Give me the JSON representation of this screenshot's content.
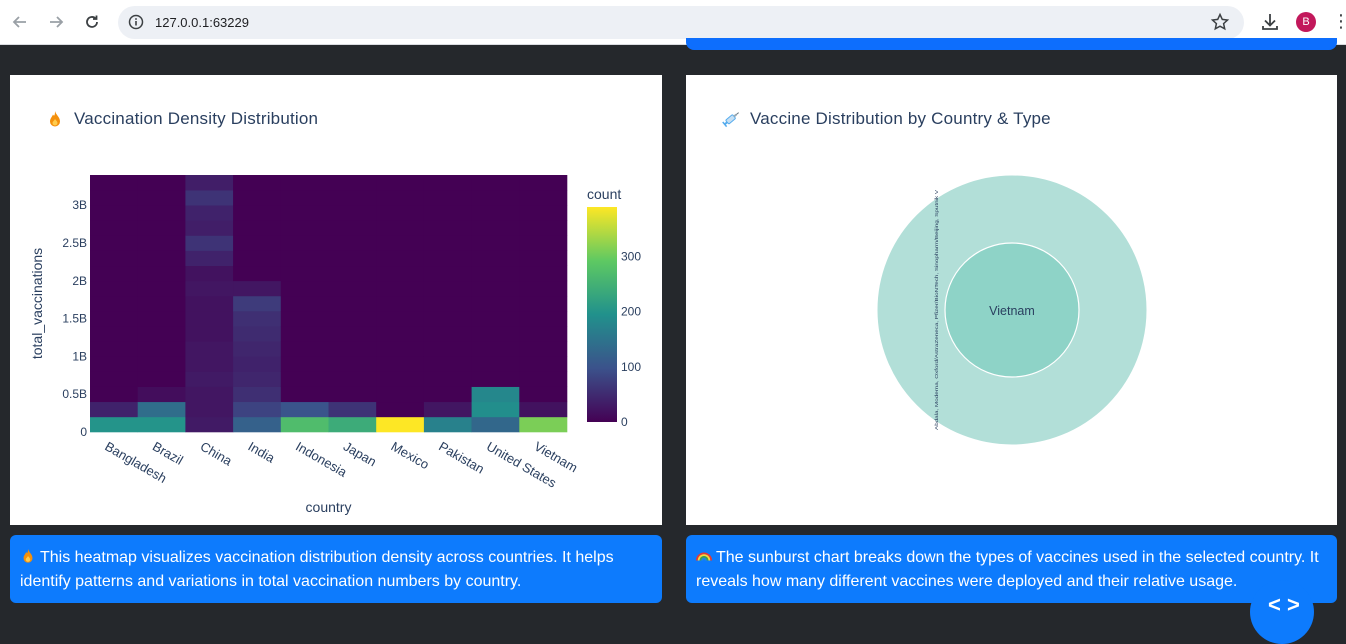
{
  "browser": {
    "url": "127.0.0.1:63229",
    "avatar_letter": "B"
  },
  "heatmap_card": {
    "title": "Vaccination Density Distribution",
    "title_icon": "fire-icon",
    "colorbar_title": "count",
    "colorbar_ticks": [
      "0",
      "100",
      "200",
      "300"
    ],
    "description": "This heatmap visualizes vaccination distribution density across countries. It helps identify patterns and variations in total vaccination numbers by country."
  },
  "sunburst_card": {
    "title": "Vaccine Distribution by Country & Type",
    "title_icon": "syringe-icon",
    "center_label": "Vietnam",
    "outer_label": "Abdala, Moderna, Oxford/AstraZeneca, Pfizer/BioNTech, Sinopharm/Beijing, Sputnik V",
    "description": "The sunburst chart breaks down the types of vaccines used in the selected country. It reveals how many different vaccines were deployed and their relative usage."
  },
  "colors": {
    "accent": "#0d7bfd",
    "sunburst_outer": "#b2dfd8",
    "sunburst_inner": "#8ed3c7"
  },
  "chart_data": [
    {
      "type": "heatmap",
      "title": "Vaccination Density Distribution",
      "xlabel": "country",
      "ylabel": "total_vaccinations",
      "categories": [
        "Bangladesh",
        "Brazil",
        "China",
        "India",
        "Indonesia",
        "Japan",
        "Mexico",
        "Pakistan",
        "United States",
        "Vietnam"
      ],
      "y_tick_labels": [
        "0",
        "0.5B",
        "1B",
        "1.5B",
        "2B",
        "2.5B",
        "3B"
      ],
      "ylim": [
        0,
        3400000000
      ],
      "bin_size": 200000000,
      "colorscale": "viridis",
      "zrange": [
        0,
        390
      ],
      "columns": [
        {
          "country": "Bangladesh",
          "counts": [
            200,
            40,
            0,
            0,
            0,
            0,
            0,
            0,
            0,
            0,
            0,
            0,
            0,
            0,
            0,
            0,
            0
          ]
        },
        {
          "country": "Brazil",
          "counts": [
            200,
            140,
            15,
            0,
            0,
            0,
            0,
            0,
            0,
            0,
            0,
            0,
            0,
            0,
            0,
            0,
            0
          ]
        },
        {
          "country": "China",
          "counts": [
            30,
            25,
            25,
            30,
            25,
            25,
            20,
            20,
            20,
            25,
            20,
            40,
            60,
            35,
            40,
            60,
            35
          ]
        },
        {
          "country": "India",
          "counts": [
            120,
            80,
            55,
            45,
            40,
            45,
            50,
            55,
            70,
            25,
            0,
            0,
            0,
            0,
            0,
            0,
            0
          ]
        },
        {
          "country": "Indonesia",
          "counts": [
            270,
            100,
            0,
            0,
            0,
            0,
            0,
            0,
            0,
            0,
            0,
            0,
            0,
            0,
            0,
            0,
            0
          ]
        },
        {
          "country": "Japan",
          "counts": [
            240,
            60,
            0,
            0,
            0,
            0,
            0,
            0,
            0,
            0,
            0,
            0,
            0,
            0,
            0,
            0,
            0
          ]
        },
        {
          "country": "Mexico",
          "counts": [
            390,
            0,
            0,
            0,
            0,
            0,
            0,
            0,
            0,
            0,
            0,
            0,
            0,
            0,
            0,
            0,
            0
          ]
        },
        {
          "country": "Pakistan",
          "counts": [
            170,
            25,
            0,
            0,
            0,
            0,
            0,
            0,
            0,
            0,
            0,
            0,
            0,
            0,
            0,
            0,
            0
          ]
        },
        {
          "country": "United States",
          "counts": [
            130,
            190,
            180,
            0,
            0,
            0,
            0,
            0,
            0,
            0,
            0,
            0,
            0,
            0,
            0,
            0,
            0
          ]
        },
        {
          "country": "Vietnam",
          "counts": [
            310,
            20,
            0,
            0,
            0,
            0,
            0,
            0,
            0,
            0,
            0,
            0,
            0,
            0,
            0,
            0,
            0
          ]
        }
      ]
    },
    {
      "type": "sunburst",
      "title": "Vaccine Distribution by Country & Type",
      "levels": [
        {
          "label": "Vietnam",
          "value": 1
        },
        {
          "label": "Abdala, Moderna, Oxford/AstraZeneca, Pfizer/BioNTech, Sinopharm/Beijing, Sputnik V",
          "parent": "Vietnam",
          "value": 1
        }
      ]
    }
  ]
}
